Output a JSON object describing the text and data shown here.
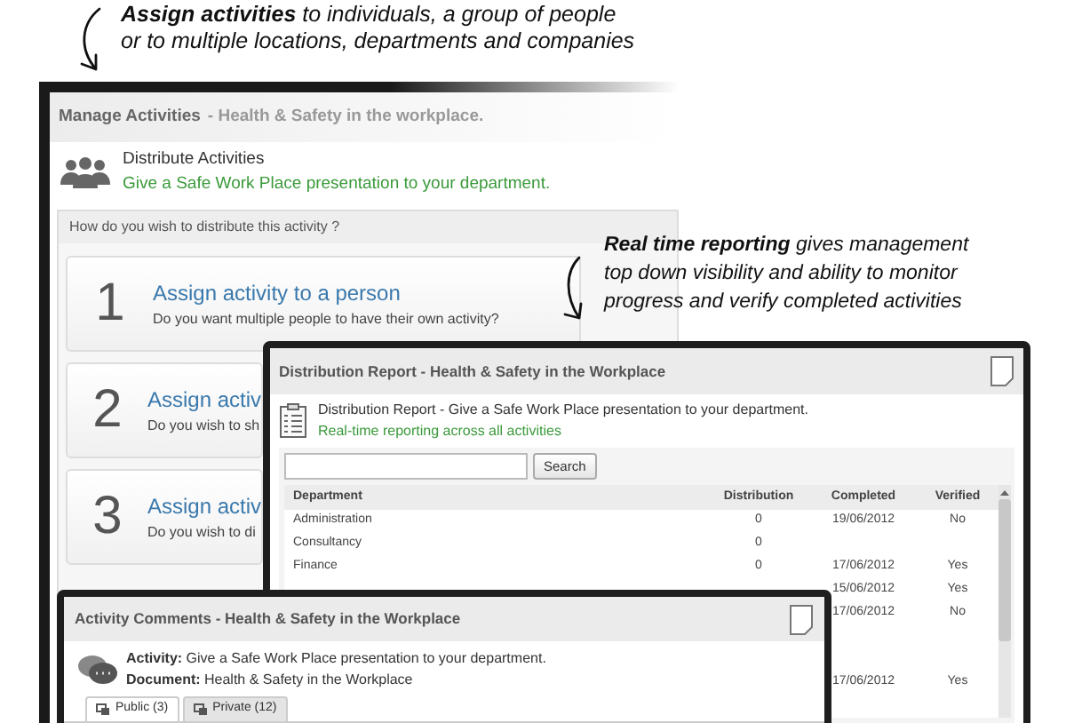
{
  "annotations": [
    {
      "lines": [
        "**Assign activities** to individuals, a group of people",
        "or to multiple locations, departments and companies"
      ]
    },
    {
      "lines": [
        "**Real time reporting** gives management",
        "top down visibility and ability to monitor",
        "progress and verify completed activities"
      ]
    }
  ],
  "manage_window": {
    "title": "Manage Activities",
    "subtitle": "- Health & Safety in the workplace.",
    "heading": "Distribute Activities",
    "description": "Give a Safe Work Place presentation to your department.",
    "question": "How do you wish to distribute this activity ?",
    "options": [
      {
        "number": "1",
        "title": "Assign activity to a person",
        "detail": "Do you want multiple people to have their own activity?"
      },
      {
        "number": "2",
        "title": "Assign activ",
        "detail": "Do you wish to sh"
      },
      {
        "number": "3",
        "title": "Assign activ",
        "detail": "Do you wish to di"
      }
    ]
  },
  "report_window": {
    "title": "Distribution Report - Health & Safety in the Workplace",
    "heading": "Distribution Report - Give a Safe Work Place presentation to your department.",
    "description": "Real-time reporting across all activities",
    "search_button": "Search",
    "columns": [
      "Department",
      "Distribution",
      "Completed",
      "Verified"
    ],
    "rows": [
      {
        "department": "Administration",
        "distribution": "0",
        "completed": "19/06/2012",
        "verified": "No"
      },
      {
        "department": "Consultancy",
        "distribution": "0"
      },
      {
        "department": "Finance",
        "distribution": "0",
        "completed": "17/06/2012",
        "verified": "Yes"
      },
      {
        "completed": "15/06/2012",
        "verified": "Yes"
      },
      {
        "completed": "17/06/2012",
        "verified": "No"
      },
      {},
      {},
      {
        "completed": "17/06/2012",
        "verified": "Yes"
      },
      {}
    ]
  },
  "comments_window": {
    "title": "Activity Comments - Health & Safety in the Workplace",
    "activity": "**Activity:** Give a Safe Work Place presentation to your department.",
    "document": "**Document:** Health & Safety in the Workplace",
    "tabs": [
      {
        "label": "Public (3)",
        "selected": true
      },
      {
        "label": "Private (12)",
        "selected": false
      }
    ]
  }
}
